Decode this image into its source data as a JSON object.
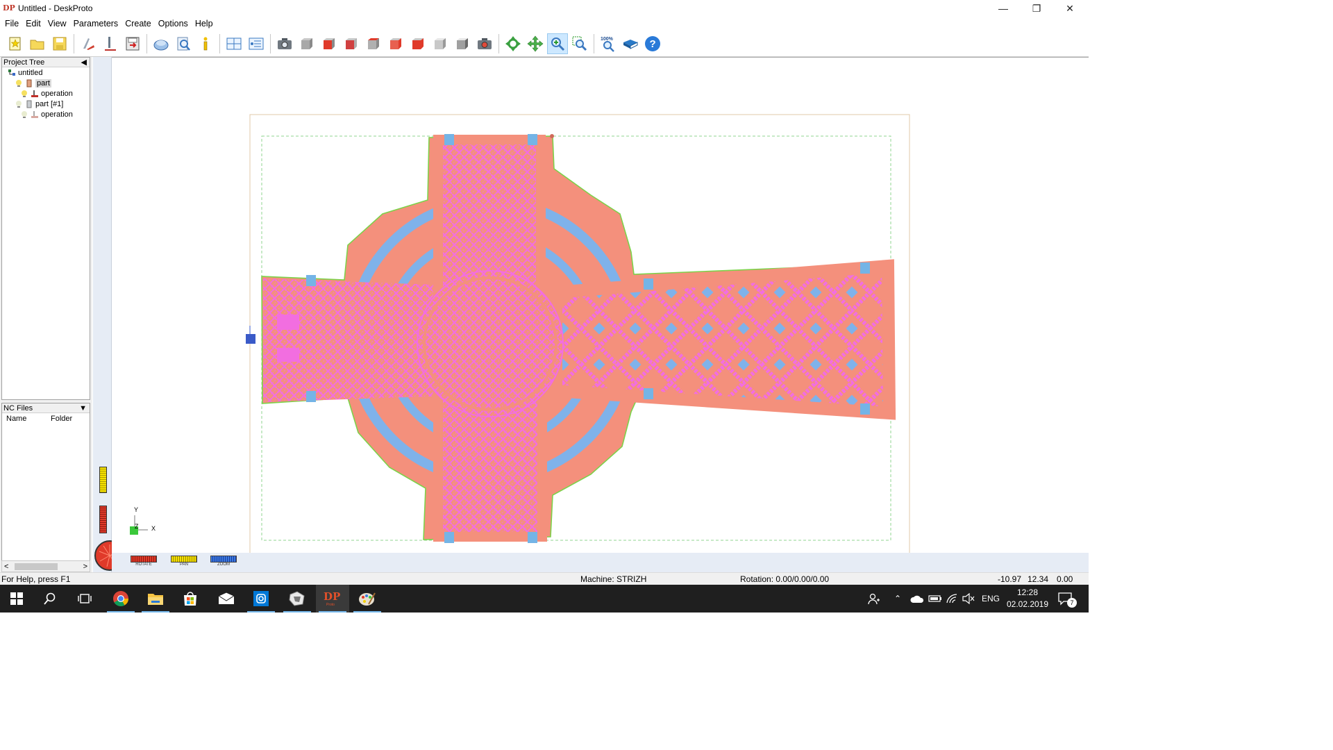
{
  "window": {
    "title": "Untitled - DeskProto",
    "icon": "deskproto-logo-icon",
    "controls": [
      "minimize",
      "restore",
      "close"
    ]
  },
  "menu": [
    "File",
    "Edit",
    "View",
    "Parameters",
    "Create",
    "Options",
    "Help"
  ],
  "toolbar": {
    "buttons": [
      "new-project-icon",
      "open-project-icon",
      "save-project-icon",
      "add-part-icon",
      "add-operation-icon",
      "save-toolpath-icon",
      "simulate-icon",
      "preview-icon",
      "info-icon",
      "layout-icon",
      "list-icon",
      "camera-icon",
      "view-front-icon",
      "view-red-icon",
      "view-side-icon",
      "view-bottom-icon",
      "view-iso1-icon",
      "view-iso2-icon",
      "view-gray-icon",
      "view-gray2-icon",
      "camera-red-icon",
      "rotate-icon",
      "pan-icon",
      "zoom-icon",
      "zoom-window-icon",
      "zoom-100-icon",
      "book-icon",
      "help-icon"
    ],
    "zoom_label": "100%"
  },
  "project_tree": {
    "header": "Project Tree",
    "items": [
      {
        "label": "untitled",
        "level": 0,
        "icon": "project-icon"
      },
      {
        "label": "part",
        "level": 1,
        "icon": "part-icon",
        "selected": true
      },
      {
        "label": "operation",
        "level": 2,
        "icon": "operation-icon"
      },
      {
        "label": "part [#1]",
        "level": 1,
        "icon": "part-icon"
      },
      {
        "label": "operation",
        "level": 2,
        "icon": "operation-icon"
      }
    ]
  },
  "nc_files": {
    "header": "NC Files",
    "columns": [
      "Name",
      "Folder"
    ]
  },
  "controls": {
    "rotate": "ROTATE",
    "pan": "PAN",
    "zoom": "ZOOM"
  },
  "axes": {
    "y": "Y",
    "z": "Z",
    "x": "X"
  },
  "status": {
    "help": "For Help, press F1",
    "machine": "Machine: STRIZH",
    "rotation": "Rotation: 0.00/0.00/0.00",
    "coord_x": "-10.97",
    "coord_y": "12.34",
    "coord_z": "0.00"
  },
  "taskbar": {
    "apps": [
      "windows-start-icon",
      "search-icon",
      "task-view-icon",
      "chrome-icon",
      "file-explorer-icon",
      "store-icon",
      "mail-icon",
      "instagram-icon",
      "app-icon",
      "deskproto-icon",
      "paint-icon"
    ],
    "tray": {
      "language": "ENG",
      "time": "12:28",
      "date": "02.02.2019",
      "notifications": "7"
    }
  },
  "colors": {
    "part_fill": "#f4907c",
    "relief_pattern": "#f26ee0",
    "ring_blue": "#7fb2ea",
    "outline_green": "#7dd24a",
    "handle_blue": "#74b4e6",
    "bounding_box": "#e0c8a8"
  }
}
